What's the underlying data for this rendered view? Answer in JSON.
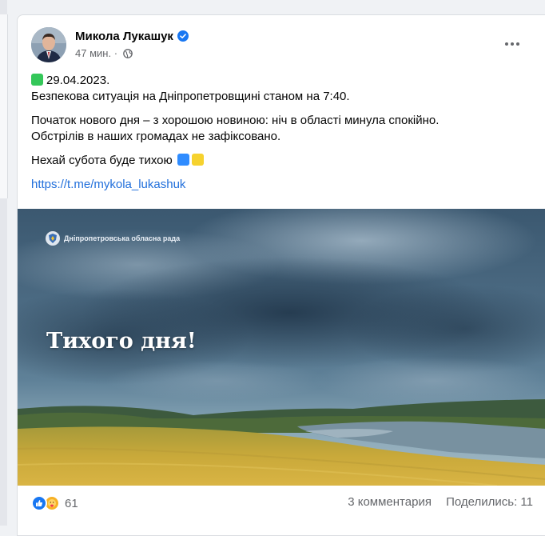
{
  "post": {
    "author": "Микола Лукашук",
    "time": "47 мин.",
    "separator": "·",
    "lines": {
      "date": "29.04.2023.",
      "status": "Безпекова ситуація на Дніпропетровщині станом на 7:40.",
      "news1": "Початок нового дня – з хорошою новиною: ніч в області минула спокійно.",
      "news2": "Обстрілів в наших громадах не зафіксовано.",
      "wish": "Нехай субота буде тихою",
      "link": "https://t.me/mykola_lukashuk"
    }
  },
  "image": {
    "brand": "Дніпропетровська обласна рада",
    "headline": "Тихого дня!"
  },
  "footer": {
    "reactions_count": "61",
    "comments": "3 комментария",
    "shares": "Поделились: 11"
  },
  "icons": {
    "verified": "verified-badge-icon",
    "audience": "globe-icon",
    "more": "more-options-icon",
    "like": "like-reaction-icon",
    "care": "care-reaction-icon"
  },
  "colors": {
    "link": "#216fdb",
    "verified": "#1877f2",
    "like": "#1877f2",
    "care": "#f7b125",
    "meta": "#65676b"
  }
}
